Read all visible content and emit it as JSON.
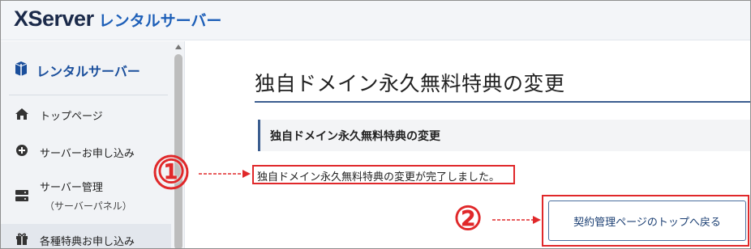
{
  "header": {
    "logo_main": "XServer",
    "logo_sub": "レンタルサーバー"
  },
  "sidebar": {
    "title": "レンタルサーバー",
    "items": [
      {
        "label": "トップページ",
        "icon": "home-icon"
      },
      {
        "label": "サーバーお申し込み",
        "icon": "plus-circle-icon"
      },
      {
        "label": "サーバー管理",
        "sub": "（サーバーパネル）",
        "icon": "server-icon"
      },
      {
        "label": "各種特典お申し込み",
        "icon": "gift-icon"
      }
    ]
  },
  "main": {
    "page_title": "独自ドメイン永久無料特典の変更",
    "section_title": "独自ドメイン永久無料特典の変更",
    "message": "独自ドメイン永久無料特典の変更が完了しました。",
    "top_button_label": "契約管理ページのトップへ戻る"
  },
  "annotations": [
    {
      "label": "①"
    },
    {
      "label": "②"
    }
  ],
  "colors": {
    "brand_blue": "#1d5fb8",
    "accent_navy": "#3b5d8f",
    "annotation_red": "#e0282a"
  }
}
